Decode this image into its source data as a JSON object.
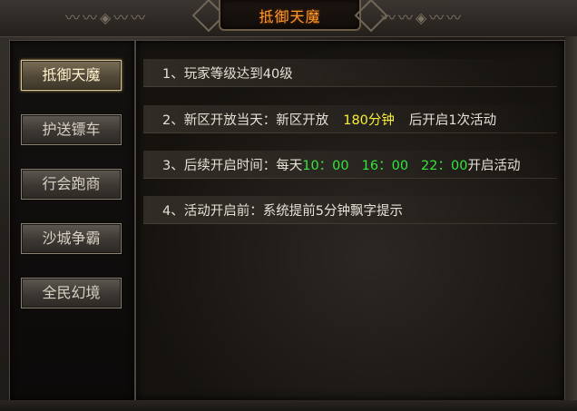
{
  "window": {
    "title": "抵御天魔",
    "ornament_left": "〰〰◈〰〰",
    "ornament_right": "〰〰◈〰〰"
  },
  "sidebar": {
    "items": [
      {
        "label": "抵御天魔",
        "active": true
      },
      {
        "label": "护送镖车",
        "active": false
      },
      {
        "label": "行会跑商",
        "active": false
      },
      {
        "label": "沙城争霸",
        "active": false
      },
      {
        "label": "全民幻境",
        "active": false
      }
    ]
  },
  "rules": {
    "line1": {
      "text": "1、玩家等级达到40级"
    },
    "line2": {
      "prefix": "2、新区开放当天：新区开放",
      "duration": "180分钟",
      "suffix": "后开启1次活动"
    },
    "line3": {
      "prefix": "3、后续开启时间：每天",
      "time1": "10：00",
      "time2": "16：00",
      "time3": "22：00",
      "suffix": "开启活动"
    },
    "line4": {
      "text": "4、活动开启前：系统提前5分钟飘字提示"
    }
  },
  "colors": {
    "title": "#ff9a2e",
    "highlight_yellow": "#f6f03a",
    "highlight_green": "#33e63a"
  }
}
